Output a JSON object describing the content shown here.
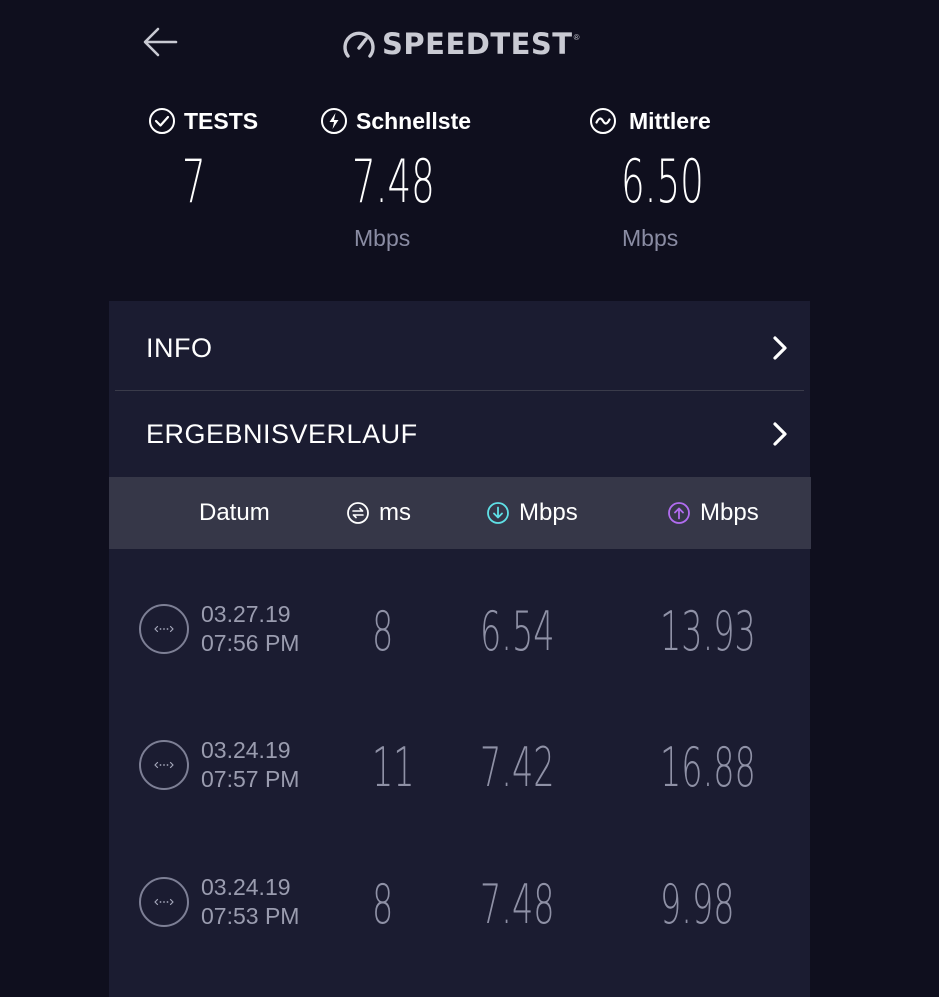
{
  "header": {
    "back_icon": "arrow-left-icon",
    "logo_icon": "speedometer-icon",
    "logo_text": "SPEEDTEST",
    "logo_tm": "®"
  },
  "stats": {
    "tests": {
      "icon": "check-circle-icon",
      "label": "TESTS",
      "value": "7"
    },
    "fastest": {
      "icon": "lightning-circle-icon",
      "label": "Schnellste",
      "value": "7.48",
      "unit": "Mbps"
    },
    "average": {
      "icon": "wave-circle-icon",
      "label": "Mittlere",
      "value": "6.50",
      "unit": "Mbps"
    }
  },
  "menu": {
    "info_label": "INFO",
    "history_label": "ERGEBNISVERLAUF"
  },
  "table": {
    "headers": {
      "date": "Datum",
      "ping": "ms",
      "download": "Mbps",
      "upload": "Mbps"
    },
    "rows": [
      {
        "date": "03.27.19",
        "time": "07:56 PM",
        "ping": "8",
        "download": "6.54",
        "upload": "13.93"
      },
      {
        "date": "03.24.19",
        "time": "07:57 PM",
        "ping": "11",
        "download": "7.42",
        "upload": "16.88"
      },
      {
        "date": "03.24.19",
        "time": "07:53 PM",
        "ping": "8",
        "download": "7.48",
        "upload": "9.98"
      }
    ]
  },
  "colors": {
    "background": "#0f0f1e",
    "panel": "#1b1c31",
    "table_header": "#363748",
    "download_accent": "#5fe0e6",
    "upload_accent": "#b16cf0"
  }
}
